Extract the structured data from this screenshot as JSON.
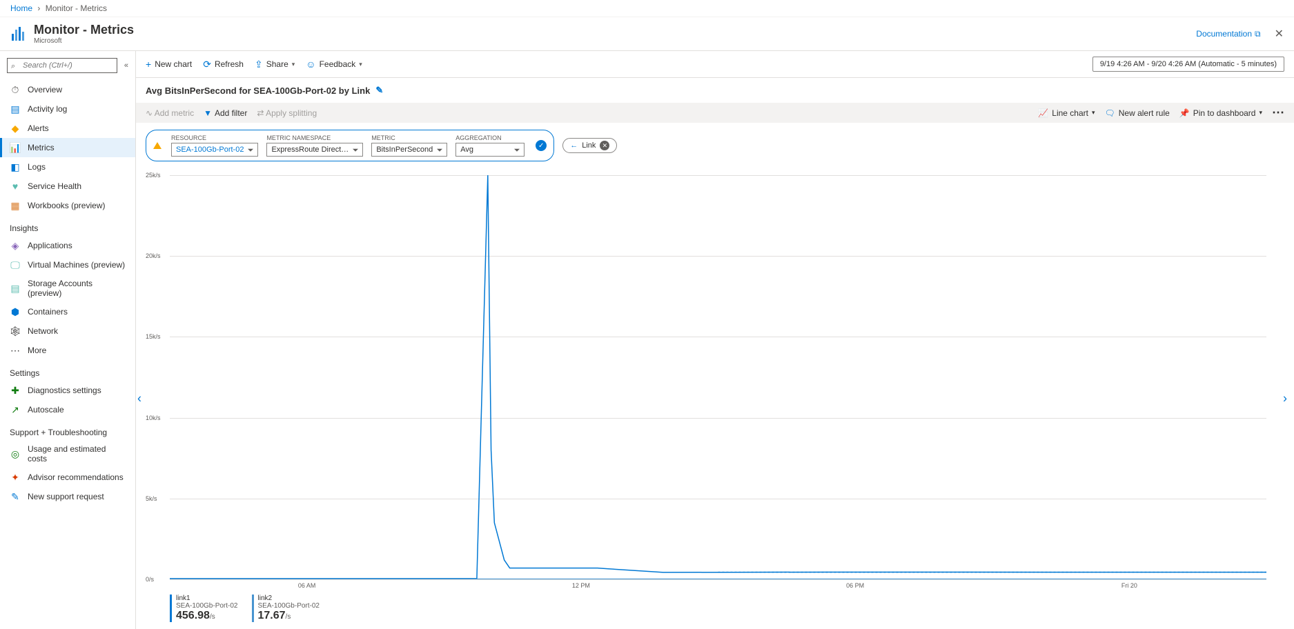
{
  "breadcrumb": {
    "home": "Home",
    "current": "Monitor - Metrics"
  },
  "header": {
    "title": "Monitor - Metrics",
    "subtitle": "Microsoft",
    "doc_link": "Documentation"
  },
  "search": {
    "placeholder": "Search (Ctrl+/)"
  },
  "sidebar": {
    "items": [
      {
        "icon": "⏱",
        "label": "Overview",
        "color": "#605e5c"
      },
      {
        "icon": "▤",
        "label": "Activity log",
        "color": "#0078d4"
      },
      {
        "icon": "◆",
        "label": "Alerts",
        "color": "#f7a800"
      },
      {
        "icon": "📊",
        "label": "Metrics",
        "color": "#0078d4",
        "active": true
      },
      {
        "icon": "◧",
        "label": "Logs",
        "color": "#0078d4"
      },
      {
        "icon": "♥",
        "label": "Service Health",
        "color": "#5bbcb0"
      },
      {
        "icon": "▦",
        "label": "Workbooks (preview)",
        "color": "#d97b29"
      }
    ],
    "insights_header": "Insights",
    "insights": [
      {
        "icon": "◈",
        "label": "Applications",
        "color": "#8764b8"
      },
      {
        "icon": "🖵",
        "label": "Virtual Machines (preview)",
        "color": "#5bbcb0"
      },
      {
        "icon": "▤",
        "label": "Storage Accounts (preview)",
        "color": "#5bbcb0"
      },
      {
        "icon": "⬢",
        "label": "Containers",
        "color": "#0078d4"
      },
      {
        "icon": "🕸",
        "label": "Network",
        "color": "#323130"
      },
      {
        "icon": "⋯",
        "label": "More",
        "color": "#323130"
      }
    ],
    "settings_header": "Settings",
    "settings": [
      {
        "icon": "✚",
        "label": "Diagnostics settings",
        "color": "#107c10"
      },
      {
        "icon": "↗",
        "label": "Autoscale",
        "color": "#107c10"
      }
    ],
    "support_header": "Support + Troubleshooting",
    "support": [
      {
        "icon": "◎",
        "label": "Usage and estimated costs",
        "color": "#107c10"
      },
      {
        "icon": "✦",
        "label": "Advisor recommendations",
        "color": "#d83b01"
      },
      {
        "icon": "✎",
        "label": "New support request",
        "color": "#0078d4"
      }
    ]
  },
  "toolbar": {
    "new_chart": "New chart",
    "refresh": "Refresh",
    "share": "Share",
    "feedback": "Feedback",
    "time_range": "9/19 4:26 AM - 9/20 4:26 AM (Automatic - 5 minutes)"
  },
  "chart_title": "Avg BitsInPerSecond for SEA-100Gb-Port-02 by Link",
  "secondary": {
    "add_metric": "Add metric",
    "add_filter": "Add filter",
    "apply_splitting": "Apply splitting",
    "chart_type": "Line chart",
    "new_alert": "New alert rule",
    "pin": "Pin to dashboard"
  },
  "selector": {
    "resource_label": "RESOURCE",
    "resource_value": "SEA-100Gb-Port-02",
    "namespace_label": "METRIC NAMESPACE",
    "namespace_value": "ExpressRoute Direct…",
    "metric_label": "METRIC",
    "metric_value": "BitsInPerSecond",
    "agg_label": "AGGREGATION",
    "agg_value": "Avg",
    "link_chip": "Link"
  },
  "legend": {
    "items": [
      {
        "name": "link1",
        "sub": "SEA-100Gb-Port-02",
        "value": "456.98",
        "unit": "/s",
        "color": "#0078d4"
      },
      {
        "name": "link2",
        "sub": "SEA-100Gb-Port-02",
        "value": "17.67",
        "unit": "/s",
        "color": "#4894d0"
      }
    ]
  },
  "chart_data": {
    "type": "line",
    "title": "Avg BitsInPerSecond for SEA-100Gb-Port-02 by Link",
    "ylabel": "k/s",
    "ylim": [
      0,
      25000
    ],
    "y_ticks": [
      "0/s",
      "5k/s",
      "10k/s",
      "15k/s",
      "20k/s",
      "25k/s"
    ],
    "x_ticks": [
      "06 AM",
      "12 PM",
      "06 PM",
      "Fri 20"
    ],
    "series": [
      {
        "name": "link1",
        "color": "#0078d4",
        "x_pct": [
          0,
          28,
          29,
          29.3,
          29.6,
          30.5,
          31,
          39,
          40,
          45,
          60,
          100
        ],
        "y": [
          50,
          50,
          25000,
          8000,
          3500,
          1200,
          700,
          700,
          650,
          430,
          450,
          440
        ],
        "dashed_from_pct": 50
      },
      {
        "name": "link2",
        "color": "#4894d0",
        "x_pct": [
          0,
          100
        ],
        "y": [
          18,
          18
        ]
      }
    ]
  }
}
